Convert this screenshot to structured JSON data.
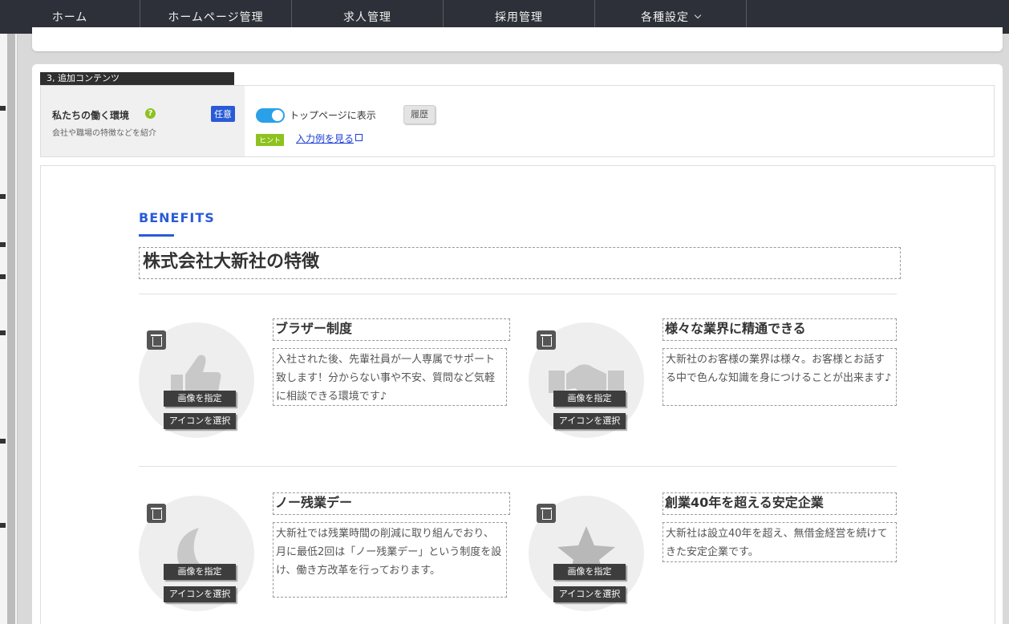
{
  "nav": {
    "items": [
      {
        "label": "ホーム"
      },
      {
        "label": "ホームページ管理"
      },
      {
        "label": "求人管理"
      },
      {
        "label": "採用管理"
      },
      {
        "label": "各種設定"
      }
    ],
    "active_index": 1
  },
  "section": {
    "label": "3, 追加コンテンツ"
  },
  "setting": {
    "title": "私たちの働く環境",
    "help_icon": "?",
    "subtitle": "会社や職場の特徴などを紹介",
    "badge": "任意",
    "toggle_label": "トップページに表示",
    "toggle_on": true,
    "history_button": "履歴",
    "hint_badge": "ヒント",
    "example_link": "入力例を見る"
  },
  "preview": {
    "eyebrow": "BENEFITS",
    "title": "株式会社大新社の特徴",
    "image_button": "画像を指定",
    "icon_button": "アイコンを選択",
    "features": [
      {
        "icon": "thumbs-up-icon",
        "title": "ブラザー制度",
        "description": "入社された後、先輩社員が一人専属でサポート致します！分からない事や不安、質問など気軽に相談できる環境です♪"
      },
      {
        "icon": "handshake-icon",
        "title": "様々な業界に精通できる",
        "description": "大新社のお客様の業界は様々。お客様とお話する中で色んな知識を身につけることが出来ます♪"
      },
      {
        "icon": "moon-icon",
        "title": "ノー残業デー",
        "description": "大新社では残業時間の削減に取り組んでおり、月に最低2回は「ノー残業デー」という制度を設け、働き方改革を行っております。"
      },
      {
        "icon": "star-icon",
        "title": "創業40年を超える安定企業",
        "description": "大新社は設立40年を超え、無借金経営を続けてきた安定企業です。"
      }
    ]
  },
  "colors": {
    "nav_bg": "#2d3038",
    "active_underline": "#8dc21f",
    "accent_blue": "#2a5bd7",
    "toggle_on": "#2aa0e8"
  }
}
